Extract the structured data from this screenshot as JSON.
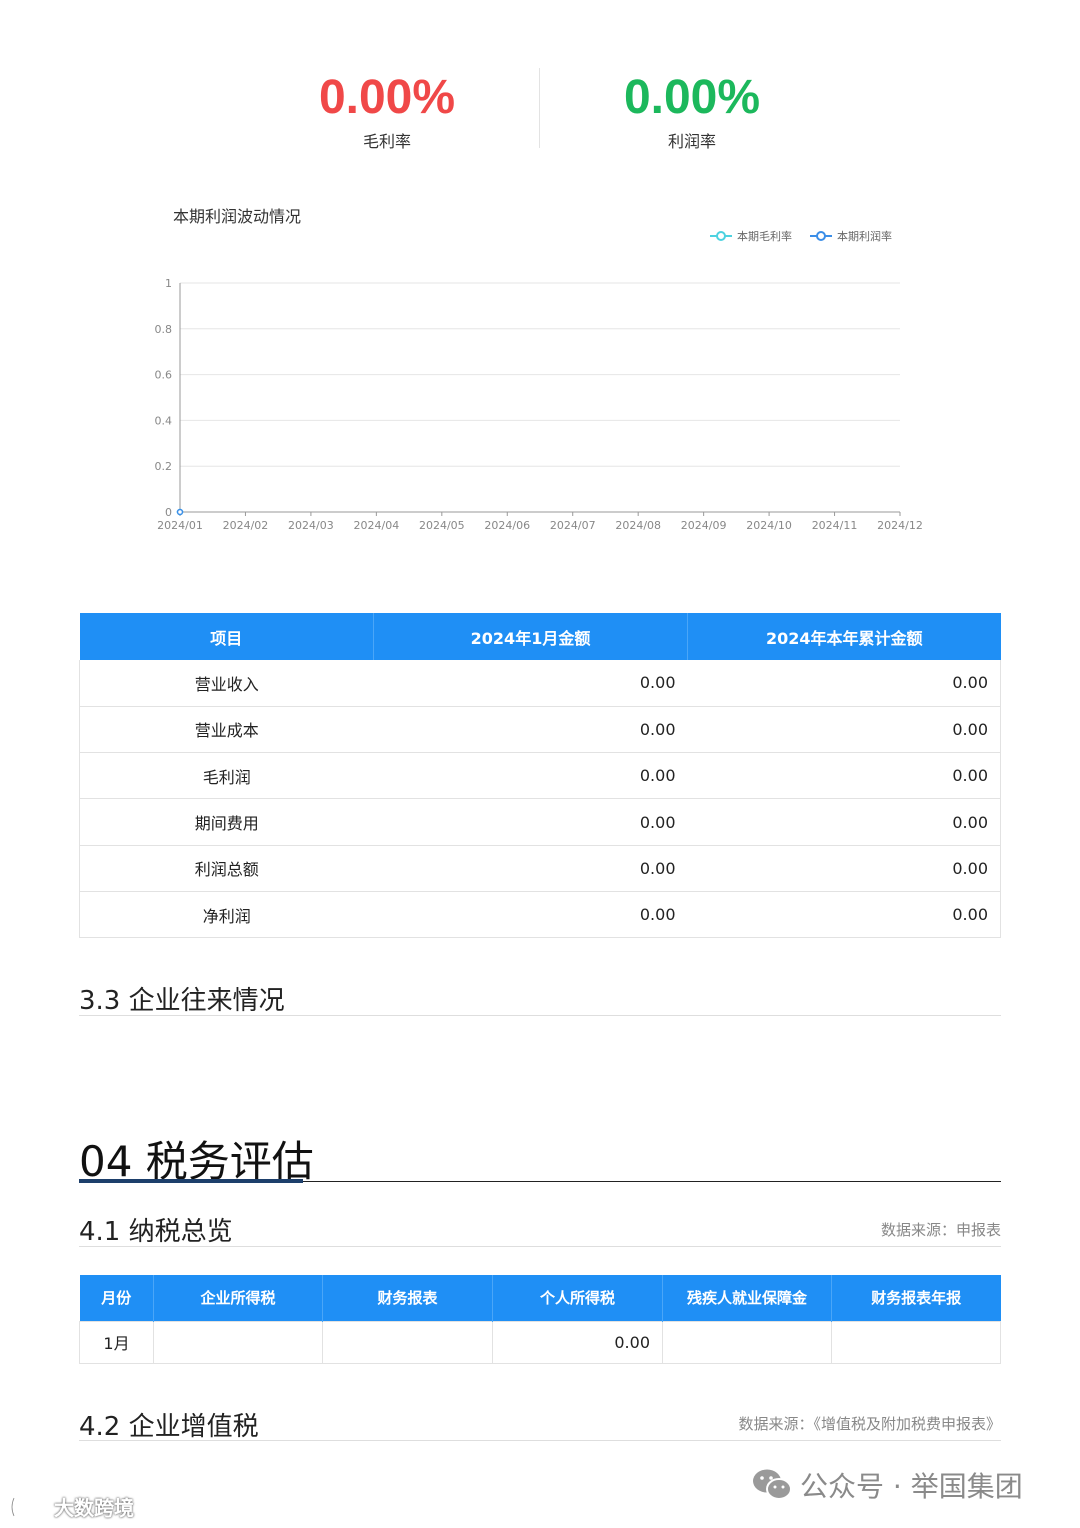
{
  "kpis": [
    {
      "value": "0.00%",
      "label": "毛利率",
      "color": "#f04848"
    },
    {
      "value": "0.00%",
      "label": "利润率",
      "color": "#1cb85c"
    }
  ],
  "chart_title": "本期利润波动情况",
  "chart_data": {
    "type": "line",
    "title": "本期利润波动情况",
    "categories": [
      "2024/01",
      "2024/02",
      "2024/03",
      "2024/04",
      "2024/05",
      "2024/06",
      "2024/07",
      "2024/08",
      "2024/09",
      "2024/10",
      "2024/11",
      "2024/12"
    ],
    "ylim": [
      0,
      1
    ],
    "yticks": [
      "0",
      "0.2",
      "0.4",
      "0.6",
      "0.8",
      "1"
    ],
    "grid": true,
    "legend_position": "top-right",
    "series": [
      {
        "name": "本期毛利率",
        "color": "#4dd2e0",
        "values": [
          0
        ]
      },
      {
        "name": "本期利润率",
        "color": "#3b8ee8",
        "values": [
          0
        ]
      }
    ]
  },
  "profit_table": {
    "headers": [
      "项目",
      "2024年1月金额",
      "2024年本年累计金额"
    ],
    "rows": [
      [
        "营业收入",
        "0.00",
        "0.00"
      ],
      [
        "营业成本",
        "0.00",
        "0.00"
      ],
      [
        "毛利润",
        "0.00",
        "0.00"
      ],
      [
        "期间费用",
        "0.00",
        "0.00"
      ],
      [
        "利润总额",
        "0.00",
        "0.00"
      ],
      [
        "净利润",
        "0.00",
        "0.00"
      ]
    ]
  },
  "section_3_3": "3.3 企业往来情况",
  "section_04": "04 税务评估",
  "section_4_1": {
    "title": "4.1 纳税总览",
    "source": "数据来源：申报表"
  },
  "tax_table": {
    "headers": [
      "月份",
      "企业所得税",
      "财务报表",
      "个人所得税",
      "残疾人就业保障金",
      "财务报表年报"
    ],
    "rows": [
      [
        "1月",
        "",
        "",
        "0.00",
        "",
        ""
      ]
    ]
  },
  "section_4_2": {
    "title": "4.2 企业增值税",
    "source": "数据来源：《增值税及附加税费申报表》"
  },
  "watermark_right": "公众号 · 举国集团",
  "watermark_left": "大数跨境"
}
